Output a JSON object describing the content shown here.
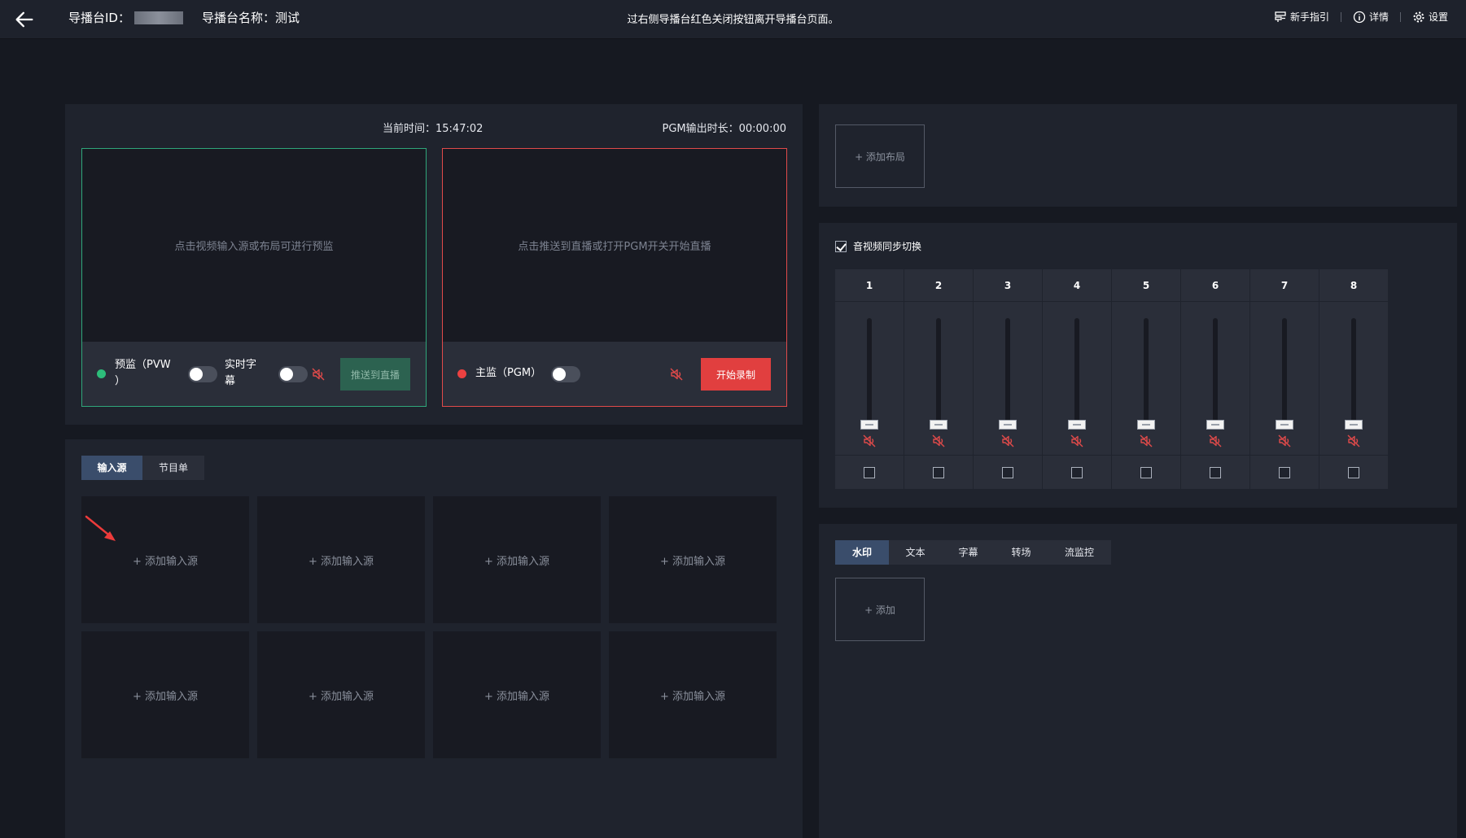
{
  "header": {
    "id_label": "导播台ID：",
    "name_label": "导播台名称：测试",
    "notice": "过右侧导播台红色关闭按钮离开导播台页面。",
    "links": [
      "新手指引",
      "详情",
      "设置"
    ]
  },
  "monitor": {
    "current_time": "当前时间：15:47:02",
    "pgm_duration": "PGM输出时长：00:00:00",
    "pvw": {
      "screen_hint": "点击视频输入源或布局可进行预监",
      "label_line1": "预监（PVW",
      "label_line2": "）",
      "subtitle_line1": "实时字",
      "subtitle_line2": "幕",
      "push_button": "推送到直播"
    },
    "pgm": {
      "screen_hint": "点击推送到直播或打开PGM开关开始直播",
      "label": "主监（PGM）",
      "record_button": "开始录制"
    }
  },
  "inputs": {
    "tabs": [
      "输入源",
      "节目单"
    ],
    "tiles": [
      "+ 添加输入源",
      "+ 添加输入源",
      "+ 添加输入源",
      "+ 添加输入源",
      "+ 添加输入源",
      "+ 添加输入源",
      "+ 添加输入源",
      "+ 添加输入源"
    ]
  },
  "layout": {
    "add_layout": "+ 添加布局"
  },
  "audio": {
    "sync_label": "音视频同步切换",
    "channels": [
      "1",
      "2",
      "3",
      "4",
      "5",
      "6",
      "7",
      "8"
    ]
  },
  "tools": {
    "tabs": [
      "水印",
      "文本",
      "字幕",
      "转场",
      "流监控"
    ],
    "add": "+ 添加"
  },
  "colors": {
    "pvw_border": "#2fa67a",
    "pgm_border": "#e04a4a",
    "record_button": "#e13f3f",
    "active_tab": "#3a4d6b",
    "mute_icon": "#e04a4a"
  }
}
